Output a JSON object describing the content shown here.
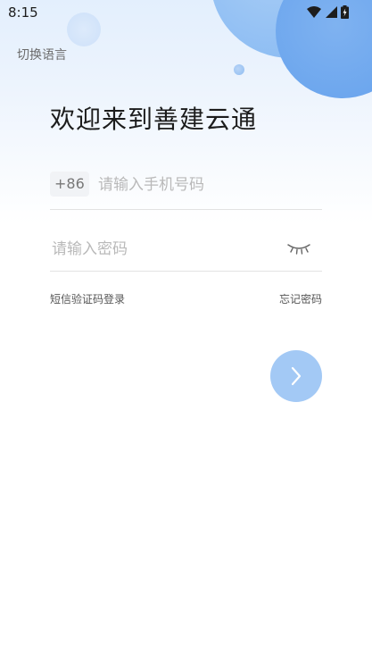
{
  "status_bar": {
    "time": "8:15",
    "icons": [
      "wifi-icon",
      "signal-icon",
      "battery-icon"
    ]
  },
  "header": {
    "language_switch": "切换语言"
  },
  "welcome": {
    "title": "欢迎来到善建云通"
  },
  "login_form": {
    "country_code": "+86",
    "phone_placeholder": "请输入手机号码",
    "phone_value": "",
    "password_placeholder": "请输入密码",
    "password_value": "",
    "password_visibility_icon": "eye-closed-icon"
  },
  "links": {
    "sms_login": "短信验证码登录",
    "forgot_password": "忘记密码"
  },
  "submit": {
    "icon": "chevron-right-icon"
  },
  "colors": {
    "accent_light": "#a3c9f5",
    "deco_blue": "#6ca6ee",
    "text_dark": "#1c1c1c",
    "placeholder": "#b9b9b9",
    "divider": "#e2e2e2"
  }
}
